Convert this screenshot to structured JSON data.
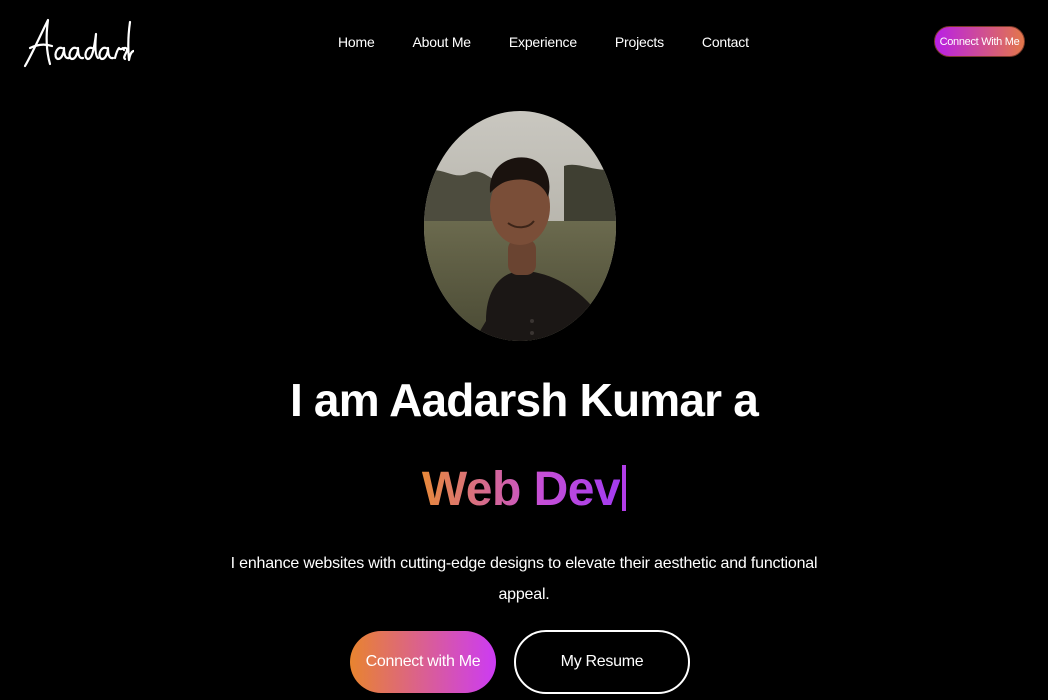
{
  "brand": {
    "logo_text": "Aadarsh"
  },
  "nav": {
    "items": [
      {
        "label": "Home"
      },
      {
        "label": "About Me"
      },
      {
        "label": "Experience"
      },
      {
        "label": "Projects"
      },
      {
        "label": "Contact"
      }
    ],
    "cta_label": "Connect With Me"
  },
  "hero": {
    "headline": "I am Aadarsh Kumar a",
    "role": "Web Dev",
    "description": "I enhance websites with cutting-edge designs to elevate their aesthetic and functional appeal.",
    "primary_button": "Connect with Me",
    "secondary_button": "My Resume"
  },
  "colors": {
    "background": "#000000",
    "accent_orange": "#e8842f",
    "accent_purple": "#cc3bf4"
  },
  "icons": {
    "avatar": "profile-photo"
  }
}
